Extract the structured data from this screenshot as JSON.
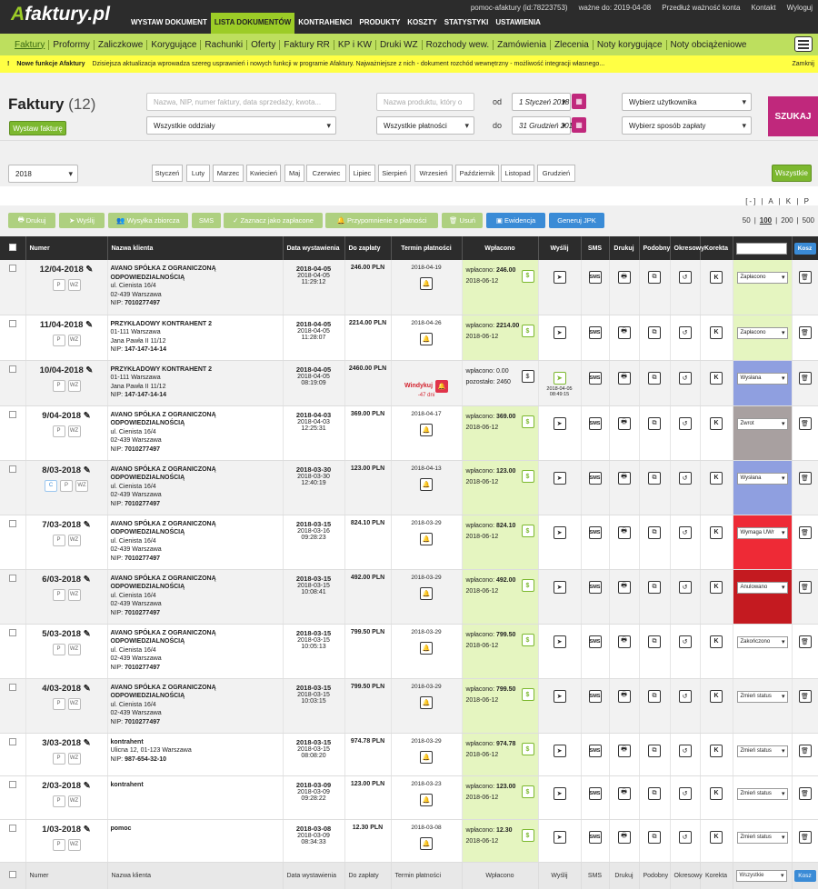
{
  "app": {
    "logo_a": "A",
    "logo_rest": "faktury.pl"
  },
  "mainnav": [
    "WYSTAW DOKUMENT",
    "LISTA DOKUMENTÓW",
    "KONTRAHENCI",
    "PRODUKTY",
    "KOSZTY",
    "STATYSTYKI",
    "USTAWIENIA"
  ],
  "topright": {
    "user": "pomoc-afaktury (id:78223753)",
    "valid": "ważne do: 2019-04-08",
    "extend": "Przedłuż ważność konta",
    "contact": "Kontakt",
    "logout": "Wyloguj"
  },
  "subnav": [
    "Faktury",
    "Proformy",
    "Zaliczkowe",
    "Korygujące",
    "Rachunki",
    "Oferty",
    "Faktury RR",
    "KP i KW",
    "Druki WZ",
    "Rozchody wew.",
    "Zamówienia",
    "Zlecenia",
    "Noty korygujące",
    "Noty obciążeniowe"
  ],
  "notice": {
    "mark": "!",
    "title": "Nowe funkcje Afaktury",
    "text": "Dzisiejsza aktualizacja wprowadza szereg usprawnień i nowych funkcji w programie Afaktury. Najważniejsze z nich - dokument rozchód wewnętrzny - możliwość integracji własnego...",
    "close": "Zamknij"
  },
  "filters": {
    "title": "Faktury",
    "count": "(12)",
    "issue_btn": "Wystaw fakturę",
    "search_ph": "Nazwa, NIP, numer faktury, data sprzedaży, kwota...",
    "branches": "Wszystkie oddziały",
    "product_ph": "Nazwa produktu, który o",
    "payments": "Wszystkie płatności",
    "from_lbl": "od",
    "to_lbl": "do",
    "date_from": "1 Styczeń 2018",
    "date_to": "31 Grudzień 2018",
    "user_sel": "Wybierz użytkownika",
    "pay_sel": "Wybierz sposób zapłaty",
    "search_btn": "SZUKAJ"
  },
  "year": "2018",
  "months": [
    "Styczeń",
    "Luty",
    "Marzec",
    "Kwiecień",
    "Maj",
    "Czerwiec",
    "Lipiec",
    "Sierpień",
    "Wrzesień",
    "Październik",
    "Listopad",
    "Grudzień"
  ],
  "all_btn": "Wszystkie",
  "view_toggle": "[-] | A | K | P",
  "actions": {
    "print": "Drukuj",
    "send": "Wyślij",
    "bulk": "Wysyłka zbiorcza",
    "sms": "SMS",
    "mark": "Zaznacz jako zapłacone",
    "remind": "Przypomnienie o płatności",
    "del": "Usuń",
    "evid": "Ewidencja",
    "jpk": "Generuj JPK"
  },
  "pager": {
    "p50": "50",
    "p100": "100",
    "p200": "200",
    "p500": "500"
  },
  "columns": {
    "num": "Numer",
    "client": "Nazwa klienta",
    "issue": "Data wystawienia",
    "due": "Do zapłaty",
    "term": "Termin płatności",
    "paid": "Wpłacono",
    "send": "Wyślij",
    "sms": "SMS",
    "print": "Drukuj",
    "similar": "Podobny",
    "periodic": "Okresowy",
    "corr": "Korekta",
    "status_filter": "Wszystkie",
    "cost": "Kosz"
  },
  "rows": [
    {
      "num": "12/04-2018",
      "tags": [
        "P",
        "WZ"
      ],
      "client": "AVANO SPÓŁKA Z OGRANICZONĄ ODPOWIEDZIALNOŚCIĄ",
      "addr1": "ul. Cienista 16/4",
      "addr2": "02-439 Warszawa",
      "nip": "7010277497",
      "d1": "2018-04-05",
      "d2": "2018-04-05",
      "t": "11:29:12",
      "amount": "246.00 PLN",
      "term": "2018-04-19",
      "paid_lbl": "wpłacono:",
      "paid_val": "246.00",
      "paid_date": "2018-06-12",
      "status": "Zapłacono",
      "color": "#e5f5c0",
      "gray": true
    },
    {
      "num": "11/04-2018",
      "tags": [
        "P",
        "WZ"
      ],
      "client": "PRZYKŁADOWY KONTRAHENT 2",
      "addr1": "01-111 Warszawa",
      "addr2": "Jana Pawła II 11/12",
      "nip": "147-147-14-14",
      "d1": "2018-04-05",
      "d2": "2018-04-05",
      "t": "11:28:07",
      "amount": "2214.00 PLN",
      "term": "2018-04-26",
      "paid_lbl": "wpłacono:",
      "paid_val": "2214.00",
      "paid_date": "2018-06-12",
      "status": "Zapłacono",
      "color": "#e5f5c0",
      "gray": false
    },
    {
      "num": "10/04-2018",
      "tags": [
        "P",
        "WZ"
      ],
      "client": "PRZYKŁADOWY KONTRAHENT 2",
      "addr1": "01-111 Warszawa",
      "addr2": "Jana Pawła II 11/12",
      "nip": "147-147-14-14",
      "d1": "2018-04-05",
      "d2": "2018-04-05",
      "t": "08:19:09",
      "amount": "2460.00 PLN",
      "term": "Windykuj",
      "overdue": "-47 dni",
      "paid_lbl": "wpłacono: 0.00",
      "paid_val": "pozostało: 2460",
      "paid_date": "",
      "sent": "2018-04-05 08:49:15",
      "status": "Wysłana",
      "color": "#8f9fe0",
      "gray": true,
      "unpaid": true
    },
    {
      "num": "9/04-2018",
      "tags": [
        "P",
        "WZ"
      ],
      "client": "AVANO SPÓŁKA Z OGRANICZONĄ ODPOWIEDZIALNOŚCIĄ",
      "addr1": "ul. Cienista 16/4",
      "addr2": "02-439 Warszawa",
      "nip": "7010277497",
      "d1": "2018-04-03",
      "d2": "2018-04-03",
      "t": "12:25:31",
      "amount": "369.00 PLN",
      "term": "2018-04-17",
      "paid_lbl": "wpłacono:",
      "paid_val": "369.00",
      "paid_date": "2018-06-12",
      "status": "Zwrot",
      "color": "#a8a0a0",
      "gray": false
    },
    {
      "num": "8/03-2018",
      "tags": [
        "C",
        "P",
        "WZ"
      ],
      "client": "AVANO SPÓŁKA Z OGRANICZONĄ ODPOWIEDZIALNOŚCIĄ",
      "addr1": "ul. Cienista 16/4",
      "addr2": "02-439 Warszawa",
      "nip": "7010277497",
      "d1": "2018-03-30",
      "d2": "2018-03-30",
      "t": "12:40:19",
      "amount": "123.00 PLN",
      "term": "2018-04-13",
      "paid_lbl": "wpłacono:",
      "paid_val": "123.00",
      "paid_date": "2018-06-12",
      "status": "Wysłana",
      "color": "#8f9fe0",
      "gray": true
    },
    {
      "num": "7/03-2018",
      "tags": [
        "P",
        "WZ"
      ],
      "client": "AVANO SPÓŁKA Z OGRANICZONĄ ODPOWIEDZIALNOŚCIĄ",
      "addr1": "ul. Cienista 16/4",
      "addr2": "02-439 Warszawa",
      "nip": "7010277497",
      "d1": "2018-03-15",
      "d2": "2018-03-16",
      "t": "09:28:23",
      "amount": "824.10 PLN",
      "term": "2018-03-29",
      "paid_lbl": "wpłacono:",
      "paid_val": "824.10",
      "paid_date": "2018-06-12",
      "status": "Wymaga UWr",
      "color": "#ee2a36",
      "gray": false
    },
    {
      "num": "6/03-2018",
      "tags": [
        "P",
        "WZ"
      ],
      "client": "AVANO SPÓŁKA Z OGRANICZONĄ ODPOWIEDZIALNOŚCIĄ",
      "addr1": "ul. Cienista 16/4",
      "addr2": "02-439 Warszawa",
      "nip": "7010277497",
      "d1": "2018-03-15",
      "d2": "2018-03-15",
      "t": "10:08:41",
      "amount": "492.00 PLN",
      "term": "2018-03-29",
      "paid_lbl": "wpłacono:",
      "paid_val": "492.00",
      "paid_date": "2018-06-12",
      "status": "Anulowano",
      "color": "#c41a20",
      "gray": true
    },
    {
      "num": "5/03-2018",
      "tags": [
        "P",
        "WZ"
      ],
      "client": "AVANO SPÓŁKA Z OGRANICZONĄ ODPOWIEDZIALNOŚCIĄ",
      "addr1": "ul. Cienista 16/4",
      "addr2": "02-439 Warszawa",
      "nip": "7010277497",
      "d1": "2018-03-15",
      "d2": "2018-03-15",
      "t": "10:05:13",
      "amount": "799.50 PLN",
      "term": "2018-03-29",
      "paid_lbl": "wpłacono:",
      "paid_val": "799.50",
      "paid_date": "2018-06-12",
      "status": "Zakończono",
      "color": "",
      "gray": false
    },
    {
      "num": "4/03-2018",
      "tags": [
        "P",
        "WZ"
      ],
      "client": "AVANO SPÓŁKA Z OGRANICZONĄ ODPOWIEDZIALNOŚCIĄ",
      "addr1": "ul. Cienista 16/4",
      "addr2": "02-439 Warszawa",
      "nip": "7010277497",
      "d1": "2018-03-15",
      "d2": "2018-03-15",
      "t": "10:03:15",
      "amount": "799.50 PLN",
      "term": "2018-03-29",
      "paid_lbl": "wpłacono:",
      "paid_val": "799.50",
      "paid_date": "2018-06-12",
      "status": "Zmień status",
      "color": "",
      "gray": true
    },
    {
      "num": "3/03-2018",
      "tags": [
        "P",
        "WZ"
      ],
      "client": "kontrahent",
      "addr1": "Ulicna 12, 01-123 Warszawa",
      "addr2": "",
      "nip": "987-654-32-10",
      "d1": "2018-03-15",
      "d2": "2018-03-15",
      "t": "08:08:20",
      "amount": "974.78 PLN",
      "term": "2018-03-29",
      "paid_lbl": "wpłacono:",
      "paid_val": "974.78",
      "paid_date": "2018-06-12",
      "status": "Zmień status",
      "color": "",
      "gray": false
    },
    {
      "num": "2/03-2018",
      "tags": [
        "P",
        "WZ"
      ],
      "client": "kontrahent",
      "addr1": "",
      "addr2": "",
      "nip": "",
      "d1": "2018-03-09",
      "d2": "2018-03-09",
      "t": "09:28:22",
      "amount": "123.00 PLN",
      "term": "2018-03-23",
      "paid_lbl": "wpłacono:",
      "paid_val": "123.00",
      "paid_date": "2018-06-12",
      "status": "Zmień status",
      "color": "",
      "gray": false
    },
    {
      "num": "1/03-2018",
      "tags": [
        "P",
        "WZ"
      ],
      "client": "pomoc",
      "addr1": "",
      "addr2": "",
      "nip": "",
      "d1": "2018-03-08",
      "d2": "2018-03-09",
      "t": "08:34:33",
      "amount": "12.30 PLN",
      "term": "2018-03-08",
      "paid_lbl": "wpłacono:",
      "paid_val": "12.30",
      "paid_date": "2018-06-12",
      "status": "Zmień status",
      "color": "",
      "gray": false
    }
  ],
  "icons": {
    "bell": "bell-icon",
    "dollar": "dollar-icon",
    "send": "send-icon",
    "sms": "sms-icon",
    "print": "printer-icon",
    "copy": "copy-icon",
    "periodic": "history-icon",
    "corr": "K",
    "trash": "trash-icon"
  }
}
